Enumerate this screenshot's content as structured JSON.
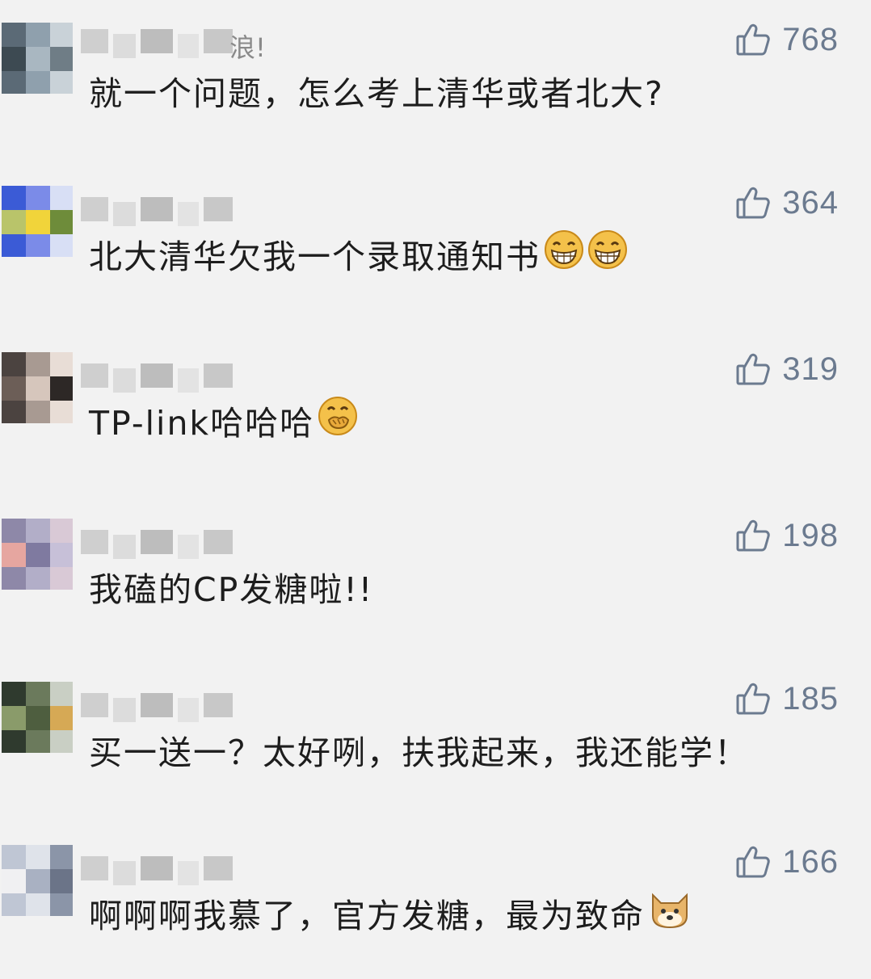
{
  "comments": [
    {
      "nickname_visible": "浪!",
      "likes": "768",
      "text": "就一个问题，怎么考上清华或者北大?",
      "emojis": [],
      "avatar_colors": [
        "#5b6a76",
        "#8fa0ad",
        "#c9d2d8",
        "#3d4a52",
        "#a9b7c1",
        "#6f7d86"
      ]
    },
    {
      "nickname_visible": "",
      "likes": "364",
      "text": "北大清华欠我一个录取通知书",
      "emojis": [
        "grinning-face-icon",
        "grinning-face-icon"
      ],
      "avatar_colors": [
        "#3b5bd6",
        "#7b8be8",
        "#d8dff5",
        "#b9c46a",
        "#f1d43a",
        "#6e8c3a"
      ]
    },
    {
      "nickname_visible": "",
      "likes": "319",
      "text": "TP-link哈哈哈",
      "emojis": [
        "face-with-hand-over-mouth-icon"
      ],
      "avatar_colors": [
        "#4b4340",
        "#a89a92",
        "#e8ddd6",
        "#6c5e57",
        "#d6c6bc",
        "#2d2826"
      ]
    },
    {
      "nickname_visible": "",
      "likes": "198",
      "text": "我磕的CP发糖啦!!",
      "emojis": [],
      "avatar_colors": [
        "#8e88a8",
        "#b2aec8",
        "#d9c9d6",
        "#e6a6a0",
        "#7f7aa0",
        "#c7c0d8"
      ]
    },
    {
      "nickname_visible": "",
      "likes": "185",
      "text": "买一送一？太好咧，扶我起来，我还能学！",
      "emojis": [],
      "avatar_colors": [
        "#2f3a2e",
        "#6b7a5c",
        "#c9cfc4",
        "#8a9b6a",
        "#4e5e3f",
        "#d6a955"
      ]
    },
    {
      "nickname_visible": "",
      "likes": "166",
      "text": "啊啊啊我慕了，官方发糖，最为致命",
      "emojis": [
        "doge-icon"
      ],
      "avatar_colors": [
        "#bfc6d4",
        "#dfe3ea",
        "#8b95a8",
        "#f0f0f2",
        "#a9b1c2",
        "#6b7488"
      ]
    }
  ],
  "colors": {
    "background": "#f2f2f2",
    "like_gray": "#6b7a8f",
    "text": "#1d1d1d"
  }
}
